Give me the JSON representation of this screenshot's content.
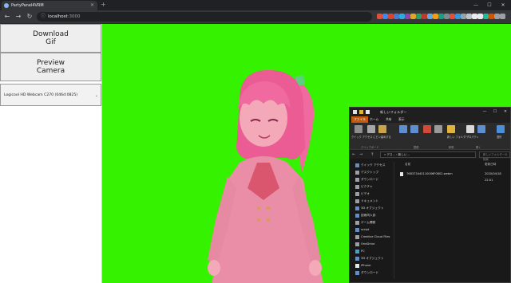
{
  "browser": {
    "tab_title": "PartyPanel4VRM",
    "new_tab_symbol": "+",
    "omnibox": {
      "host": "localhost",
      "port": ":3000"
    },
    "nav": {
      "back": "←",
      "forward": "→",
      "reload": "↻",
      "lock": "ⓘ"
    },
    "extension_colors": [
      "#e44d3a",
      "#3b8beb",
      "#d64532",
      "#4a7bd1",
      "#2ea9df",
      "#8e44ad",
      "#e2a52a",
      "#26a269",
      "#c0392b",
      "#5dade2",
      "#f39c12",
      "#16a085",
      "#7f8c8d",
      "#e74c3c",
      "#3498db",
      "#95a5a6",
      "#bdc3c7",
      "#e8eaed",
      "#e8eaed",
      "#1abc9c",
      "#d35400",
      "#9aa0a6",
      "#9aa0a6"
    ],
    "window_controls": {
      "minimize": "—",
      "maximize": "☐",
      "close": "✕"
    }
  },
  "app": {
    "background_color": "#35f200",
    "buttons": {
      "download_gif": "Download\nGif",
      "preview_camera": "Preview\nCamera"
    },
    "camera_select": {
      "value": "Logicool HD Webcam C270 (046d:0825)",
      "caret": "⌄"
    }
  },
  "explorer": {
    "title": "新しいフォルダー",
    "tabs": [
      "ファイル",
      "ホーム",
      "共有",
      "表示"
    ],
    "ribbon": {
      "buttons": [
        "クイック アクセス にピン留めする",
        "コピー",
        "貼り付け",
        "移動先",
        "コピー先",
        "削除",
        "名前の 変更",
        "新しい フォルダー",
        "プロパティ",
        "開く",
        "選択"
      ],
      "groups": [
        "クリップボード",
        "整理",
        "新規",
        "開く"
      ]
    },
    "address": "« デス... › 新しい...",
    "search_placeholder": "新しいフォルダーの検索",
    "nav_items": [
      "クイック アクセス",
      "デスクトップ",
      "ダウンロード",
      "ピクチャ",
      "ビデオ",
      "ドキュメント",
      "3D オブジェクト",
      "技術同人誌",
      "ゲーム開発",
      "script",
      "Creative Cloud Files",
      "OneDrive",
      "PC",
      "3D オブジェクト",
      "iPhone",
      "ダウンロード"
    ],
    "columns": {
      "name": "名前",
      "date": "更新日時"
    },
    "files": [
      {
        "name": "768373440110006F0802.webm",
        "date": "2020/04/18 22:01"
      }
    ],
    "status": ""
  }
}
